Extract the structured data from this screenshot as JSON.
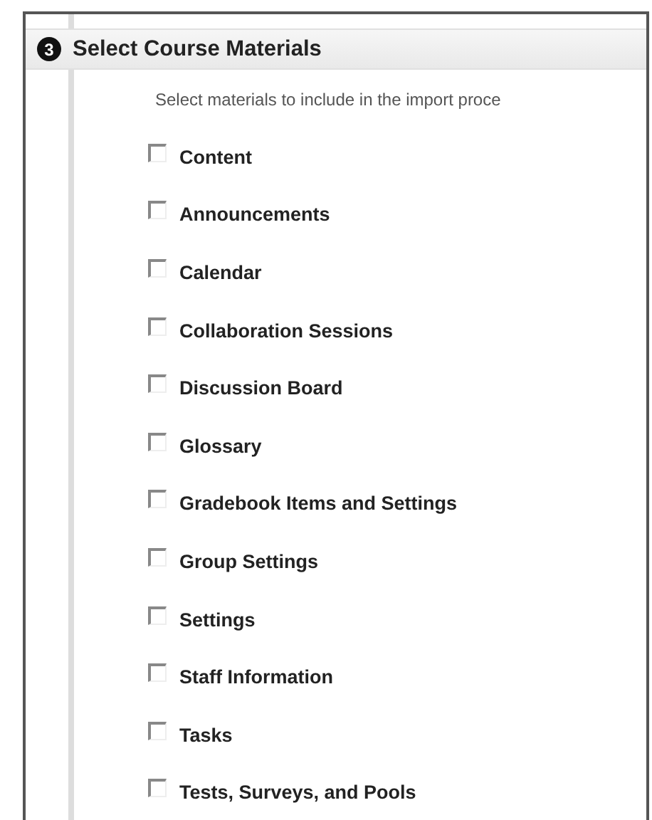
{
  "section": {
    "step": "3",
    "title": "Select Course Materials",
    "instruction": "Select materials to include in the import proce"
  },
  "materials": [
    {
      "label": "Content",
      "checked": false
    },
    {
      "label": "Announcements",
      "checked": false
    },
    {
      "label": "Calendar",
      "checked": false
    },
    {
      "label": "Collaboration Sessions",
      "checked": false
    },
    {
      "label": "Discussion Board",
      "checked": false
    },
    {
      "label": "Glossary",
      "checked": false
    },
    {
      "label": "Gradebook Items and Settings",
      "checked": false
    },
    {
      "label": "Group Settings",
      "checked": false
    },
    {
      "label": "Settings",
      "checked": false
    },
    {
      "label": "Staff Information",
      "checked": false
    },
    {
      "label": "Tasks",
      "checked": false
    },
    {
      "label": "Tests, Surveys, and Pools",
      "checked": false
    }
  ]
}
